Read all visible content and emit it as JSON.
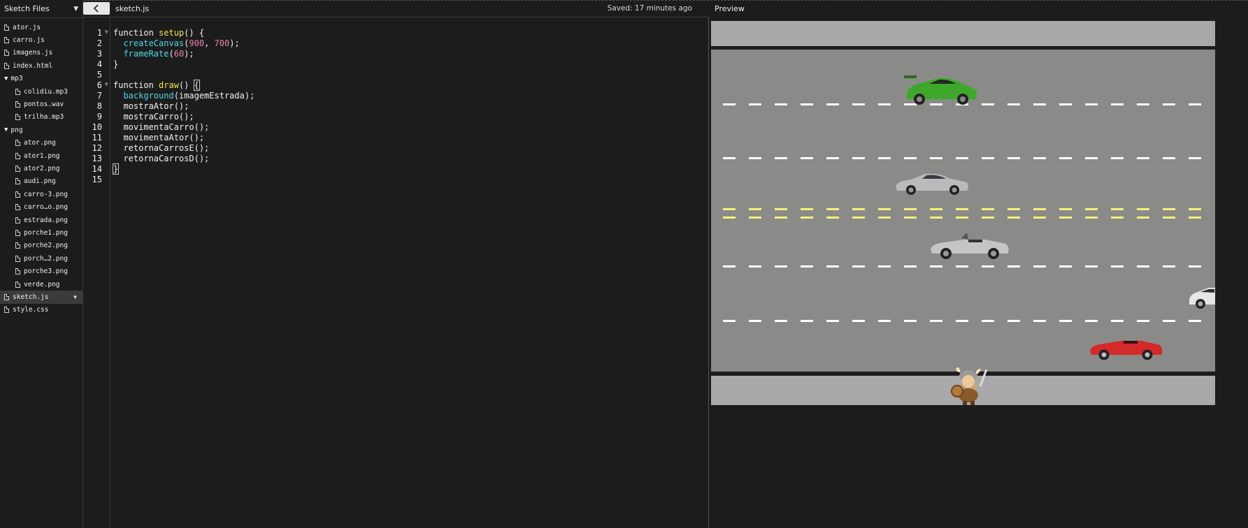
{
  "sidebar": {
    "title": "Sketch Files",
    "files": [
      {
        "name": "ator.js",
        "type": "file",
        "level": 0
      },
      {
        "name": "carro.js",
        "type": "file",
        "level": 0
      },
      {
        "name": "imagens.js",
        "type": "file",
        "level": 0
      },
      {
        "name": "index.html",
        "type": "file",
        "level": 0
      },
      {
        "name": "mp3",
        "type": "folder",
        "level": 0
      },
      {
        "name": "colidiu.mp3",
        "type": "file",
        "level": 1
      },
      {
        "name": "pontos.wav",
        "type": "file",
        "level": 1
      },
      {
        "name": "trilha.mp3",
        "type": "file",
        "level": 1
      },
      {
        "name": "png",
        "type": "folder",
        "level": 0
      },
      {
        "name": "ator.png",
        "type": "file",
        "level": 1
      },
      {
        "name": "ator1.png",
        "type": "file",
        "level": 1
      },
      {
        "name": "ator2.png",
        "type": "file",
        "level": 1
      },
      {
        "name": "audi.png",
        "type": "file",
        "level": 1
      },
      {
        "name": "carro-3.png",
        "type": "file",
        "level": 1
      },
      {
        "name": "carro…o.png",
        "type": "file",
        "level": 1
      },
      {
        "name": "estrada.png",
        "type": "file",
        "level": 1
      },
      {
        "name": "porche1.png",
        "type": "file",
        "level": 1
      },
      {
        "name": "porche2.png",
        "type": "file",
        "level": 1
      },
      {
        "name": "porch…2.png",
        "type": "file",
        "level": 1
      },
      {
        "name": "porche3.png",
        "type": "file",
        "level": 1
      },
      {
        "name": "verde.png",
        "type": "file",
        "level": 1
      },
      {
        "name": "sketch.js",
        "type": "file",
        "level": 0,
        "active": true
      },
      {
        "name": "style.css",
        "type": "file",
        "level": 0
      }
    ]
  },
  "editor": {
    "collapse_icon": "chevron-left-icon",
    "file_name": "sketch.js",
    "saved_status": "Saved: 17 minutes ago",
    "line_numbers": [
      "1",
      "2",
      "3",
      "4",
      "5",
      "6",
      "7",
      "8",
      "9",
      "10",
      "11",
      "12",
      "13",
      "14",
      "15"
    ],
    "lines": [
      [
        {
          "t": "function ",
          "c": "kw"
        },
        {
          "t": "setup",
          "c": "fn"
        },
        {
          "t": "() {",
          "c": "kw"
        }
      ],
      [
        {
          "t": "  ",
          "c": "kw"
        },
        {
          "t": "createCanvas",
          "c": "bi"
        },
        {
          "t": "(",
          "c": "kw"
        },
        {
          "t": "900",
          "c": "num"
        },
        {
          "t": ", ",
          "c": "kw"
        },
        {
          "t": "700",
          "c": "num"
        },
        {
          "t": ");",
          "c": "kw"
        }
      ],
      [
        {
          "t": "  ",
          "c": "kw"
        },
        {
          "t": "frameRate",
          "c": "bi"
        },
        {
          "t": "(",
          "c": "kw"
        },
        {
          "t": "60",
          "c": "num"
        },
        {
          "t": ");",
          "c": "kw"
        }
      ],
      [
        {
          "t": "}",
          "c": "kw"
        }
      ],
      [],
      [
        {
          "t": "function ",
          "c": "kw"
        },
        {
          "t": "draw",
          "c": "fn"
        },
        {
          "t": "() ",
          "c": "kw"
        },
        {
          "t": "{",
          "c": "brk"
        }
      ],
      [
        {
          "t": "  ",
          "c": "kw"
        },
        {
          "t": "background",
          "c": "bi"
        },
        {
          "t": "(imagemEstrada);",
          "c": "kw"
        }
      ],
      [
        {
          "t": "  mostraAtor();",
          "c": "kw"
        }
      ],
      [
        {
          "t": "  mostraCarro();",
          "c": "kw"
        }
      ],
      [
        {
          "t": "  movimentaCarro();",
          "c": "kw"
        }
      ],
      [
        {
          "t": "  movimentaAtor();",
          "c": "kw"
        }
      ],
      [
        {
          "t": "  retornaCarrosE();",
          "c": "kw"
        }
      ],
      [
        {
          "t": "  retornaCarrosD();",
          "c": "kw"
        }
      ],
      [
        {
          "t": "}",
          "c": "brk"
        }
      ],
      []
    ]
  },
  "preview": {
    "label": "Preview",
    "cars": [
      {
        "name": "green-porsche-car",
        "color": "#3fa82c"
      },
      {
        "name": "silver-porsche-car",
        "color": "#b9babc"
      },
      {
        "name": "silver-convertible-car",
        "color": "#c4c5c7"
      },
      {
        "name": "white-car-partial",
        "color": "#e6e6e6"
      },
      {
        "name": "red-convertible-car",
        "color": "#d42a2a"
      }
    ],
    "actor": "viking-actor-sprite"
  }
}
